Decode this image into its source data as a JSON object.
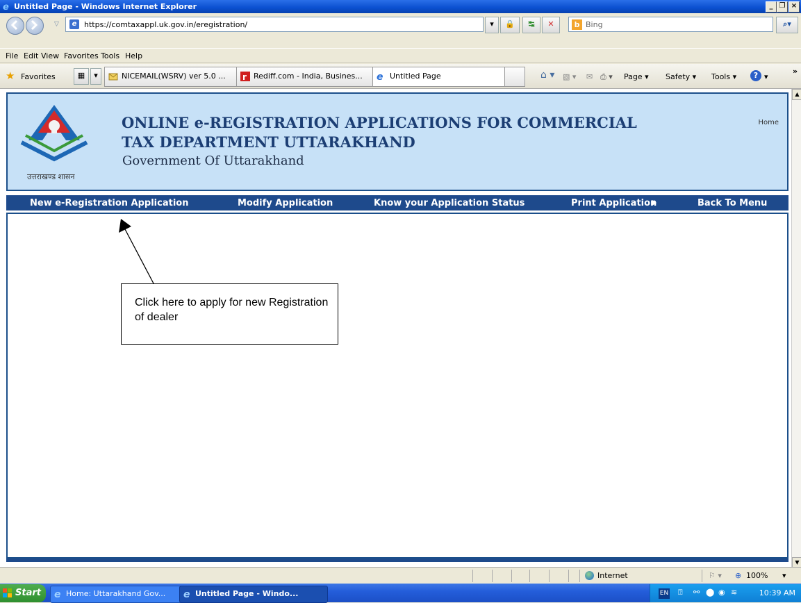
{
  "window": {
    "title": "Untitled Page - Windows Internet Explorer"
  },
  "address": {
    "url": "https://comtaxappl.uk.gov.in/eregistration/",
    "search_placeholder": "Bing"
  },
  "menu": {
    "items": [
      "File",
      "Edit",
      "View",
      "Favorites",
      "Tools",
      "Help"
    ]
  },
  "favorites": {
    "label": "Favorites",
    "tabs": [
      "NICEMAIL(WSRV) ver 5.0 ...",
      "Rediff.com - India, Busines...",
      "Untitled Page"
    ],
    "toolbar": [
      "Page",
      "Safety",
      "Tools"
    ]
  },
  "page": {
    "header_title_line1": "ONLINE e-REGISTRATION APPLICATIONS FOR COMMERCIAL",
    "header_title_line2": "TAX DEPARTMENT UTTARAKHAND",
    "header_subtitle": "Government Of Uttarakhand",
    "emblem_caption": "उत्तराखण्ड शासन",
    "home_link": "Home",
    "nav": [
      "New e-Registration Application",
      "Modify Application",
      "Know your Application Status",
      "Print Application",
      "Back To Menu"
    ],
    "callout": "Click here to apply for new Registration of dealer"
  },
  "status": {
    "zone": "Internet",
    "zoom": "100%"
  },
  "taskbar": {
    "start": "Start",
    "buttons": [
      "Home: Uttarakhand Gov...",
      "Untitled Page - Windo..."
    ],
    "lang": "EN",
    "clock": "10:39 AM"
  }
}
